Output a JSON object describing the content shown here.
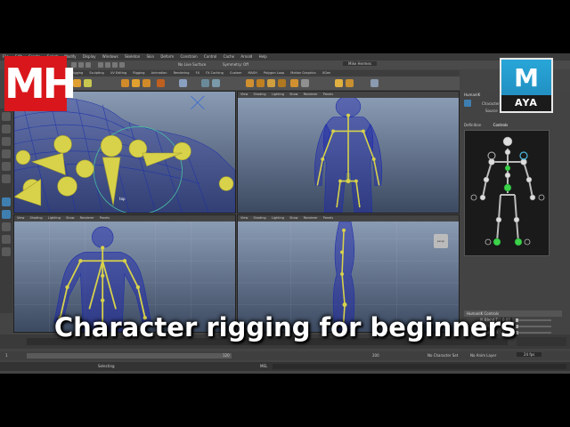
{
  "menubar": [
    "File",
    "Edit",
    "Create",
    "Select",
    "Modify",
    "Display",
    "Windows",
    "Skeleton",
    "Skin",
    "Deform",
    "Constrain",
    "Control",
    "Cache",
    "Arnold",
    "Help"
  ],
  "status_fields": {
    "no_live_surface": "No Live Surface",
    "symmetry": "Symmetry: Off",
    "user": "Mike Hermes"
  },
  "shelf_tabs": [
    "Rigging",
    "Sculpting",
    "UV Editing",
    "Rigging",
    "Animation",
    "Rendering",
    "FX",
    "FX Caching",
    "Custom",
    "MASH",
    "Polygon Loop",
    "Motion Graphics",
    "XGen"
  ],
  "viewport_menu": [
    "View",
    "Shading",
    "Lighting",
    "Show",
    "Renderer",
    "Panels"
  ],
  "viewport_labels": {
    "top_left_camera": "top",
    "bottom_right_tag": "persp"
  },
  "right_panel": {
    "title": "HumanIK",
    "char_label": "Character",
    "source_label": "Source",
    "tabs": [
      "Definition",
      "Controls"
    ],
    "active_tab": "Controls"
  },
  "hik_controls": {
    "header": "HumanIK Controls",
    "rows": [
      {
        "label": "IK Blend T",
        "value": "0.00"
      },
      {
        "label": "IK Blend R",
        "value": "0.00"
      },
      {
        "label": "IK Pull",
        "value": "0.00"
      }
    ]
  },
  "bottom": {
    "start": "1",
    "end": "120",
    "range_end": "200",
    "no_char": "No Character Set",
    "no_anim": "No Anim Layer",
    "fps": "24 fps",
    "cmd_label": "MEL",
    "status": "Selecting"
  },
  "logos": {
    "mh": "MH",
    "maya_m": "M",
    "maya_sub": "AYA"
  },
  "title": "Character rigging for beginners",
  "colors": {
    "accent_red": "#d9161b",
    "maya_blue": "#28a6d8",
    "mesh_blue": "#1e2fa8",
    "joint_yellow": "#d8d24a"
  }
}
